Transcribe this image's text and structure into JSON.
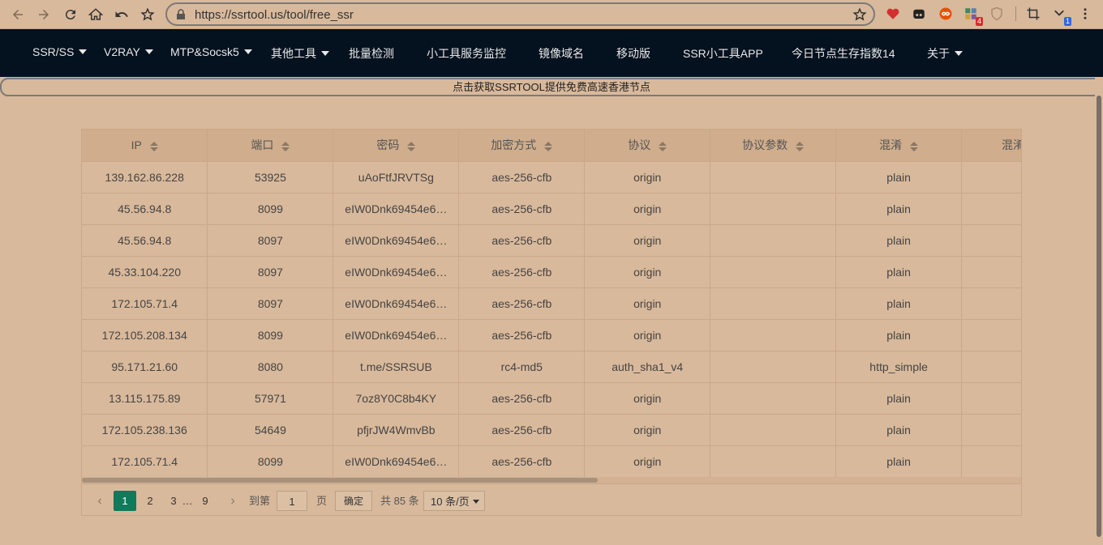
{
  "browser": {
    "url": "https://ssrtool.us/tool/free_ssr",
    "extensions": [
      {
        "name": "heart-icon",
        "color": "#d32f2f"
      },
      {
        "name": "tamper-icon",
        "color": "#222222"
      },
      {
        "name": "infinity-icon",
        "color": "#e65100"
      },
      {
        "name": "puzzle-icon",
        "color": "#3b8a5a",
        "badge": "4",
        "badge_color": "#d32f2f"
      },
      {
        "name": "shield-icon",
        "color": "#b08d6e"
      },
      {
        "name": "crop-icon",
        "color": "#333333"
      },
      {
        "name": "download-icon",
        "color": "#333333",
        "badge": "1",
        "badge_color": "#3367d6"
      }
    ]
  },
  "nav": {
    "items": [
      {
        "label": "SSR/SS",
        "dropdown": true
      },
      {
        "label": "V2RAY",
        "dropdown": true
      },
      {
        "label": "MTP&Socsk5",
        "dropdown": true
      },
      {
        "label": "其他工具",
        "dropdown": true
      },
      {
        "label": "批量检测",
        "dropdown": false
      },
      {
        "label": "小工具服务监控",
        "dropdown": false
      },
      {
        "label": "镜像域名",
        "dropdown": false
      },
      {
        "label": "移动版",
        "dropdown": false
      },
      {
        "label": "SSR小工具APP",
        "dropdown": false
      },
      {
        "label": "今日节点生存指数14",
        "dropdown": false
      },
      {
        "label": "关于",
        "dropdown": true
      }
    ]
  },
  "banner": {
    "text": "点击获取SSRTOOL提供免费高速香港节点"
  },
  "table": {
    "headers": [
      "IP",
      "端口",
      "密码",
      "加密方式",
      "协议",
      "协议参数",
      "混淆",
      "混淆参数"
    ],
    "rows": [
      [
        "139.162.86.228",
        "53925",
        "uAoFtfJRVTSg",
        "aes-256-cfb",
        "origin",
        "",
        "plain",
        ""
      ],
      [
        "45.56.94.8",
        "8099",
        "eIW0Dnk69454e6…",
        "aes-256-cfb",
        "origin",
        "",
        "plain",
        ""
      ],
      [
        "45.56.94.8",
        "8097",
        "eIW0Dnk69454e6…",
        "aes-256-cfb",
        "origin",
        "",
        "plain",
        ""
      ],
      [
        "45.33.104.220",
        "8097",
        "eIW0Dnk69454e6…",
        "aes-256-cfb",
        "origin",
        "",
        "plain",
        ""
      ],
      [
        "172.105.71.4",
        "8097",
        "eIW0Dnk69454e6…",
        "aes-256-cfb",
        "origin",
        "",
        "plain",
        ""
      ],
      [
        "172.105.208.134",
        "8099",
        "eIW0Dnk69454e6…",
        "aes-256-cfb",
        "origin",
        "",
        "plain",
        ""
      ],
      [
        "95.171.21.60",
        "8080",
        "t.me/SSRSUB",
        "rc4-md5",
        "auth_sha1_v4",
        "",
        "http_simple",
        ""
      ],
      [
        "13.115.175.89",
        "57971",
        "7oz8Y0C8b4KY",
        "aes-256-cfb",
        "origin",
        "",
        "plain",
        ""
      ],
      [
        "172.105.238.136",
        "54649",
        "pfjrJW4WmvBb",
        "aes-256-cfb",
        "origin",
        "",
        "plain",
        ""
      ],
      [
        "172.105.71.4",
        "8099",
        "eIW0Dnk69454e6…",
        "aes-256-cfb",
        "origin",
        "",
        "plain",
        ""
      ]
    ]
  },
  "pagination": {
    "pages": [
      "1",
      "2",
      "3",
      "…",
      "9"
    ],
    "active_page": "1",
    "goto_label": "到第",
    "goto_value": "1",
    "page_unit": "页",
    "confirm_label": "确定",
    "total_text": "共 85 条",
    "page_size": "10 条/页"
  }
}
